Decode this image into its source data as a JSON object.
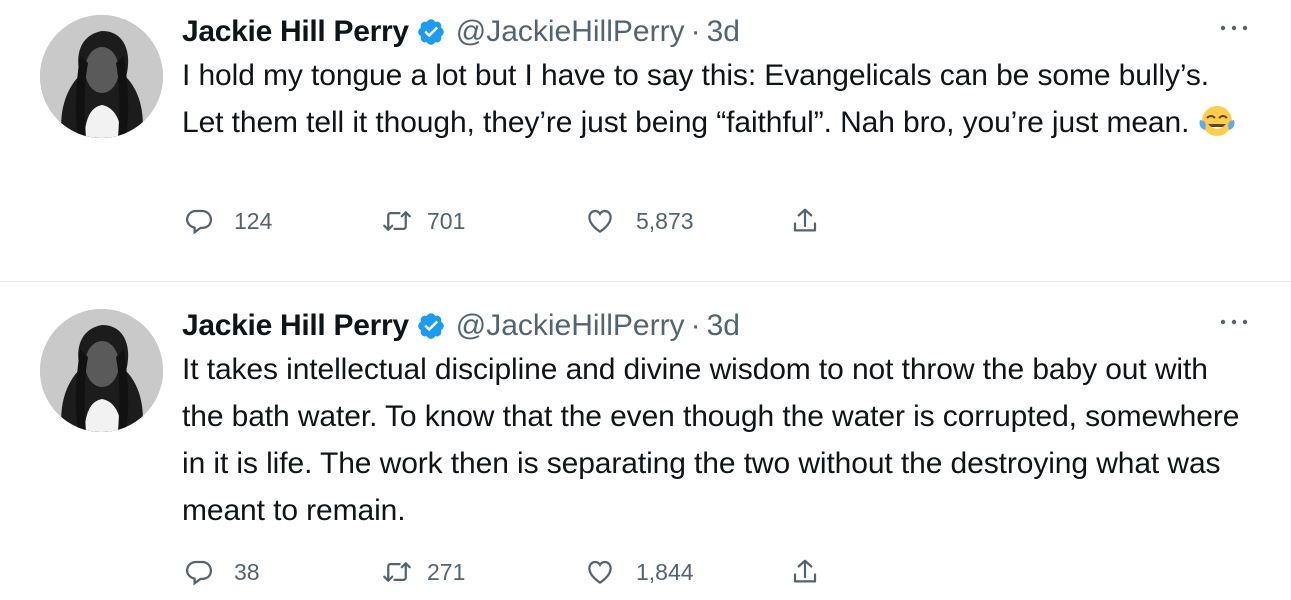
{
  "tweets": [
    {
      "author": {
        "name": "Jackie Hill Perry",
        "handle": "@JackieHillPerry",
        "verified_icon": "verified-badge-icon"
      },
      "separator": "·",
      "time": "3d",
      "text": "I hold my tongue a lot but I have to say this: Evangelicals can be some bully’s. Let them tell it though, they’re just being “faithful”. Nah bro, you’re just mean.",
      "emoji": "face-with-tears-of-joy",
      "stats": {
        "replies": "124",
        "retweets": "701",
        "likes": "5,873"
      }
    },
    {
      "author": {
        "name": "Jackie Hill Perry",
        "handle": "@JackieHillPerry",
        "verified_icon": "verified-badge-icon"
      },
      "separator": "·",
      "time": "3d",
      "text": "It takes intellectual discipline and divine wisdom to not throw the baby out with the bath water. To know that the even though the water is corrupted, somewhere in it is life. The work then is separating the two without the destroying what was meant to remain.",
      "emoji": "",
      "stats": {
        "replies": "38",
        "retweets": "271",
        "likes": "1,844"
      }
    }
  ],
  "colors": {
    "text": "#0f1419",
    "secondary": "#536471",
    "verified": "#1d9bf0",
    "divider": "#e6ecf0"
  },
  "icons": [
    "reply-icon",
    "retweet-icon",
    "like-icon",
    "share-icon",
    "more-icon",
    "verified-badge-icon",
    "avatar"
  ]
}
